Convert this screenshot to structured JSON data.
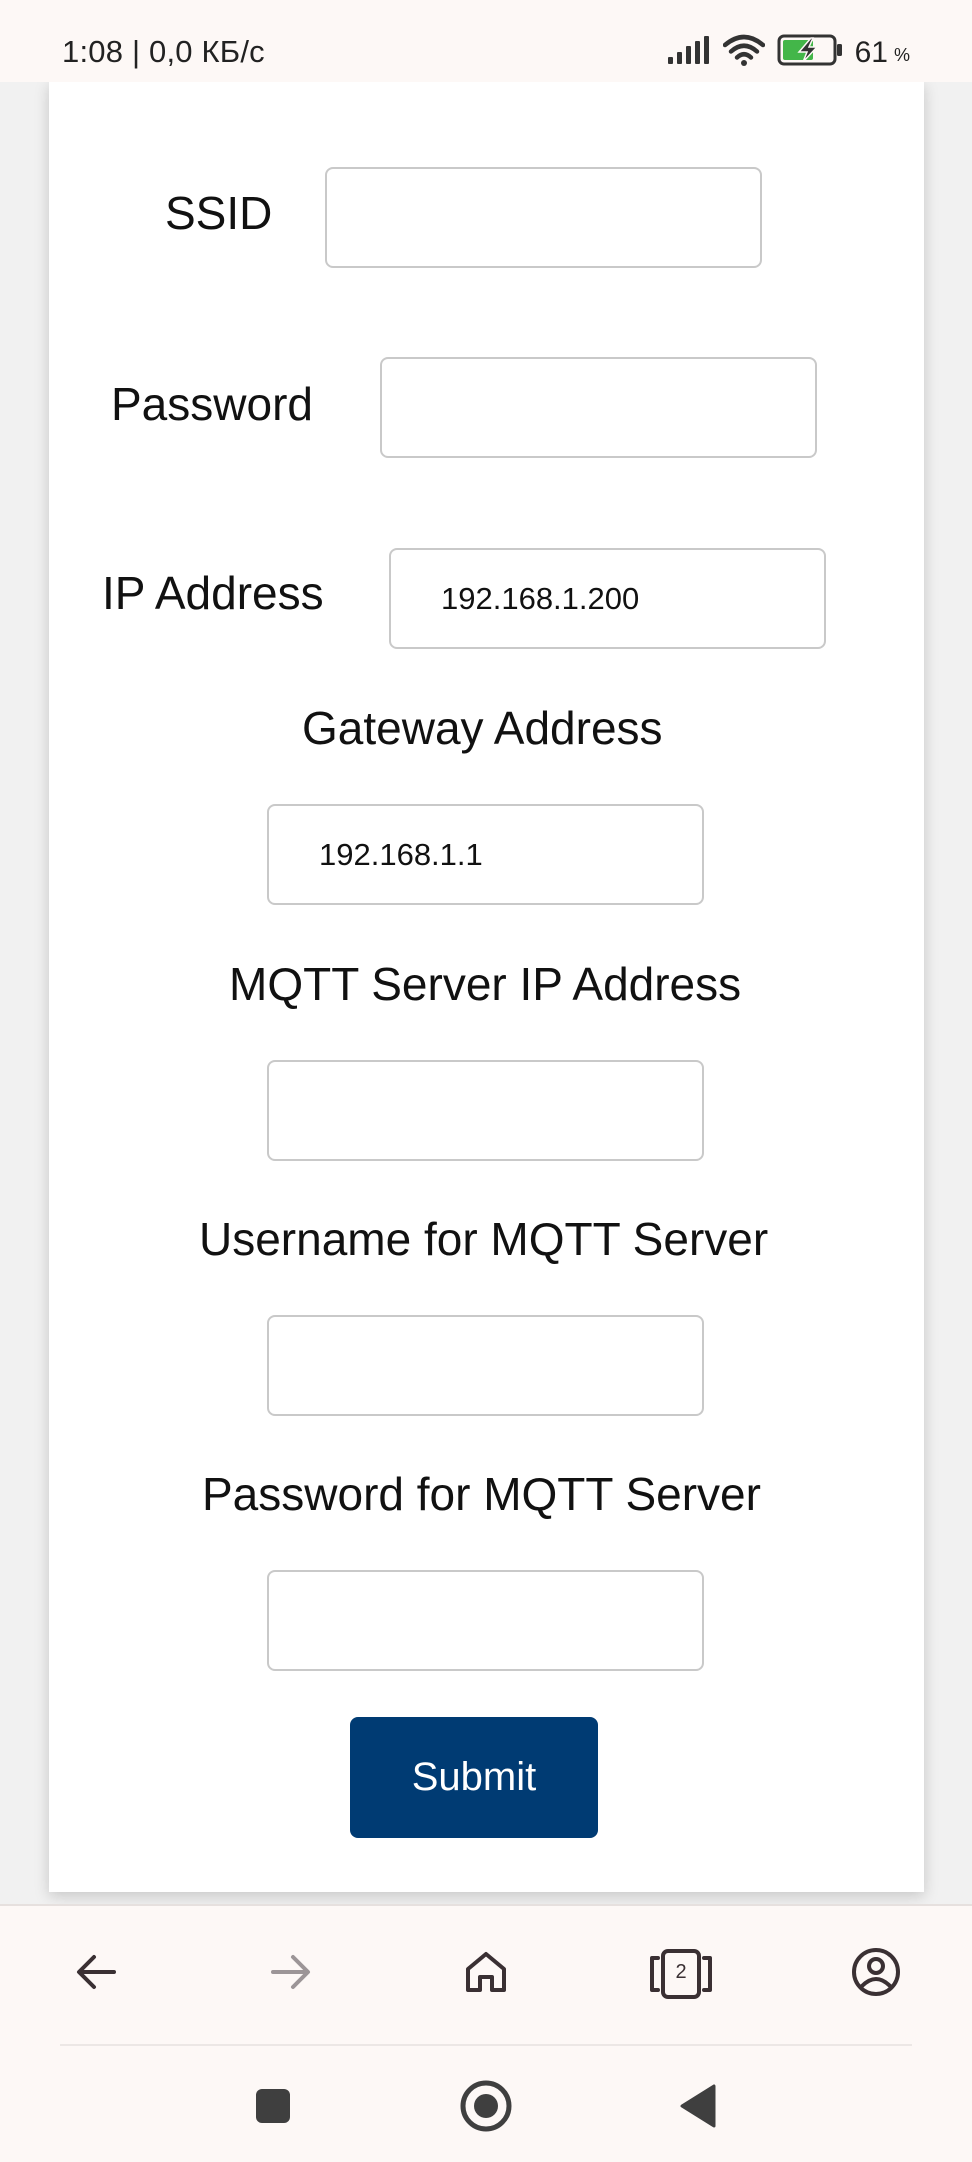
{
  "status_bar": {
    "time_speed": "1:08 | 0,0 КБ/с",
    "battery_percent": "61",
    "battery_unit": "%",
    "icons": [
      "signal-icon",
      "wifi-icon",
      "battery-charging-icon"
    ]
  },
  "form": {
    "ssid": {
      "label": "SSID",
      "value": "",
      "placeholder": ""
    },
    "password": {
      "label": "Password",
      "value": "",
      "placeholder": ""
    },
    "ip_address": {
      "label": "IP Address",
      "value": "192.168.1.200",
      "placeholder": ""
    },
    "gateway_address": {
      "label": "Gateway Address",
      "value": "192.168.1.1",
      "placeholder": ""
    },
    "mqtt_server_ip": {
      "label": "MQTT Server IP Address",
      "value": "",
      "placeholder": ""
    },
    "mqtt_username": {
      "label": "Username for MQTT Server",
      "value": "",
      "placeholder": ""
    },
    "mqtt_password": {
      "label": "Password for MQTT Server",
      "value": "",
      "placeholder": ""
    },
    "submit_label": "Submit"
  },
  "browser_toolbar": {
    "tab_count": "2",
    "icons": [
      "back-arrow-icon",
      "forward-arrow-icon",
      "home-icon",
      "tabs-icon",
      "account-icon"
    ]
  },
  "system_nav": {
    "icons": [
      "recents-square-icon",
      "home-circle-icon",
      "back-triangle-icon"
    ]
  },
  "colors": {
    "submit_background": "#003b73",
    "submit_text": "#ffffff",
    "field_border": "#c9c9c9",
    "bar_background": "#fdf8f6",
    "page_background": "#f1f1f1",
    "card_background": "#ffffff",
    "battery_green": "#43b649"
  }
}
